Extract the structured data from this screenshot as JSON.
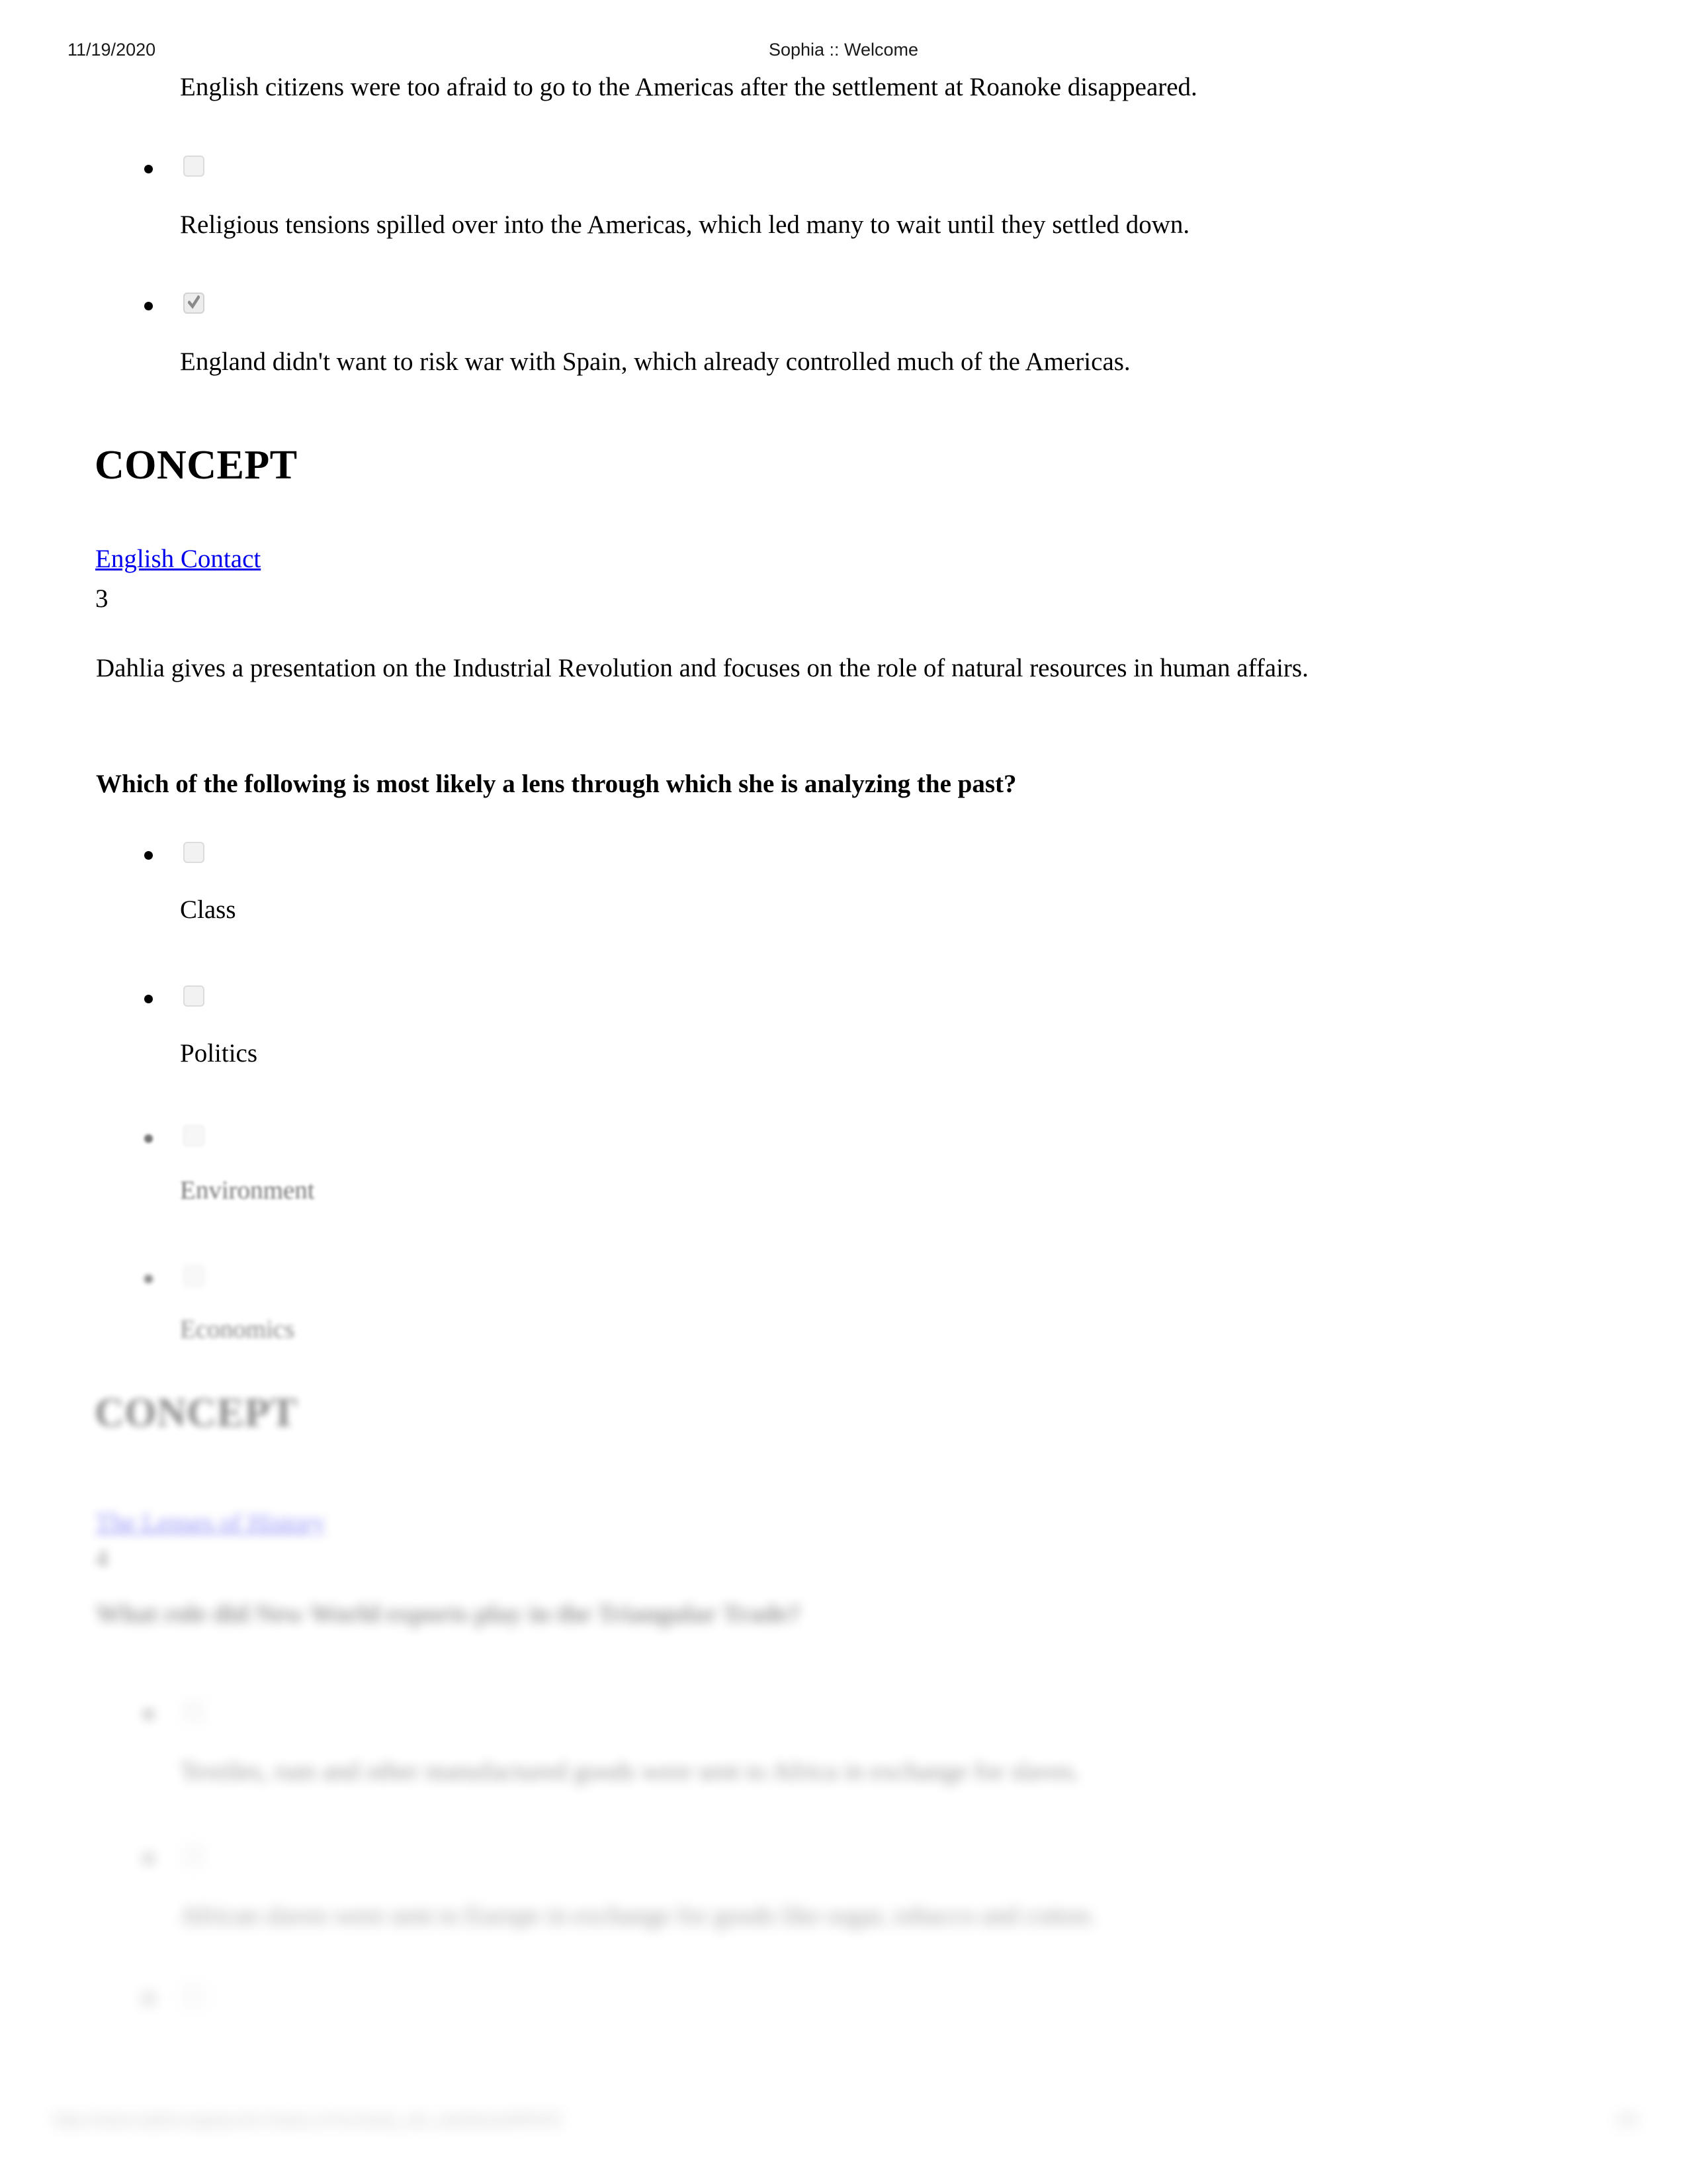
{
  "header": {
    "date": "11/19/2020",
    "title": "Sophia :: Welcome"
  },
  "question_1_tail": {
    "option_2_text": "English citizens were too afraid to go to the Americas after the settlement at Roanoke disappeared.",
    "option_3_text": "Religious tensions spilled over into the Americas, which led many to wait until they settled down.",
    "option_4_text": "England didn't want to risk war with Spain, which already controlled much of the Americas.",
    "option_3_checked": false,
    "option_4_checked": true
  },
  "concept_1": {
    "heading": "CONCEPT",
    "link": "English Contact"
  },
  "question_2": {
    "number": "3",
    "stem": "Dahlia gives a presentation on the Industrial Revolution and focuses on the role of natural resources in human affairs.",
    "prompt": "Which of the following is most likely a lens through which she is analyzing the past?",
    "options": [
      {
        "label": "Class",
        "checked": false
      },
      {
        "label": "Politics",
        "checked": false
      },
      {
        "label": "Environment",
        "checked": false
      },
      {
        "label": "Economics",
        "checked": false
      }
    ]
  },
  "concept_2": {
    "heading": "CONCEPT",
    "link": "The Lenses of History"
  },
  "question_3": {
    "number": "4",
    "prompt": "What role did New World exports play in the Triangular Trade?",
    "options": [
      {
        "label": "Textiles, rum and other manufactured goods were sent to Africa in exchange for slaves.",
        "checked": false
      },
      {
        "label": "African slaves were sent to Europe in exchange for goods like sugar, tobacco and cotton.",
        "checked": false
      },
      {
        "label": "",
        "checked": false
      }
    ]
  },
  "footer": {
    "url": "https://www.sophia.org/spcc/en-history-of-humanity_ubc_dashboard/9/5/5/5",
    "page": "2/5"
  }
}
